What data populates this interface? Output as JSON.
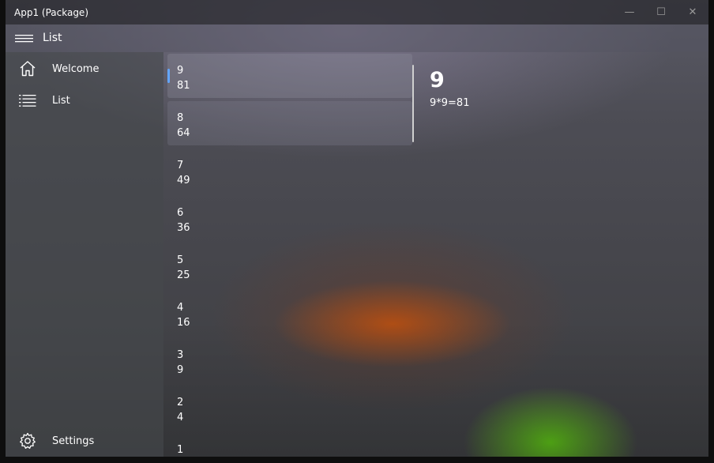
{
  "window": {
    "title": "App1 (Package)",
    "caption_buttons": {
      "minimize": "—",
      "maximize": "☐",
      "close": "✕"
    }
  },
  "header": {
    "title": "List",
    "menu_icon": "hamburger-icon"
  },
  "nav": {
    "items": [
      {
        "label": "Welcome",
        "icon": "home-icon"
      },
      {
        "label": "List",
        "icon": "list-icon"
      }
    ],
    "footer": {
      "label": "Settings",
      "icon": "gear-icon"
    }
  },
  "list": {
    "items": [
      {
        "number": "9",
        "square": "81"
      },
      {
        "number": "8",
        "square": "64"
      },
      {
        "number": "7",
        "square": "49"
      },
      {
        "number": "6",
        "square": "36"
      },
      {
        "number": "5",
        "square": "25"
      },
      {
        "number": "4",
        "square": "16"
      },
      {
        "number": "3",
        "square": "9"
      },
      {
        "number": "2",
        "square": "4"
      },
      {
        "number": "1",
        "square": ""
      }
    ],
    "selected_index": 0
  },
  "detail": {
    "title": "9",
    "formula": "9*9=81"
  },
  "colors": {
    "accent": "#63a6ff",
    "text": "#ffffff"
  }
}
